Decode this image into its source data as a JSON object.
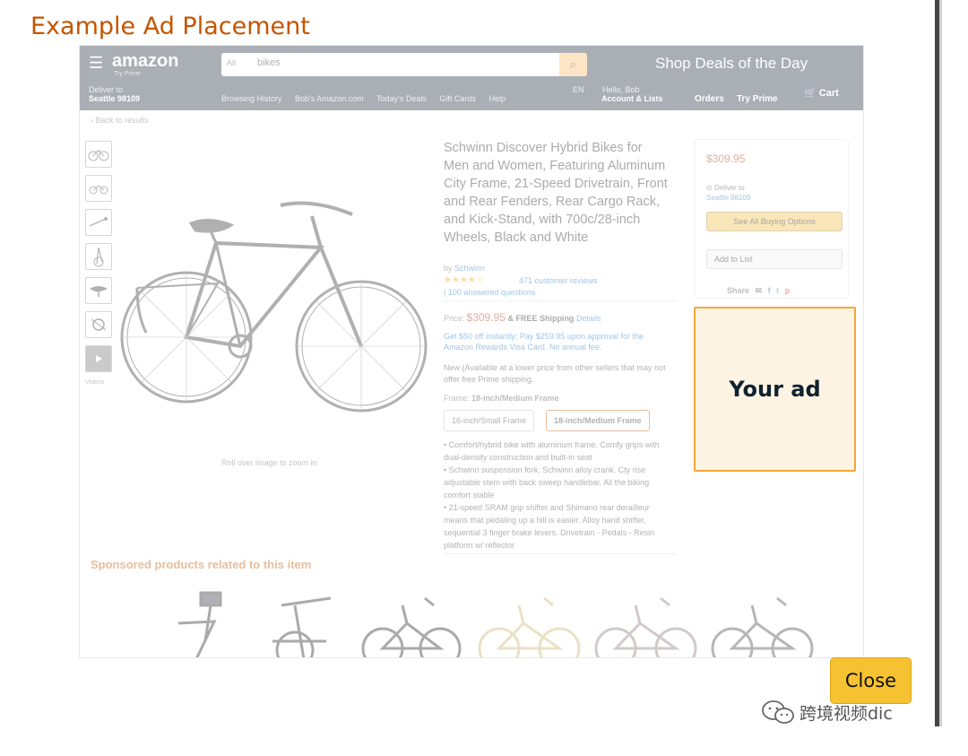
{
  "modal": {
    "title": "Example Ad Placement",
    "close_label": "Close"
  },
  "ad": {
    "label": "Your ad",
    "fill_color": "#fdf3e3",
    "border_color": "#f4a836"
  },
  "amazon_page": {
    "header": {
      "logo": "amazon",
      "logo_sub": "Try Prime",
      "search_department": "All",
      "search_query": "bikes",
      "deals_text": "Shop Deals of the Day",
      "deliver_line1": "Deliver to",
      "deliver_line2": "Seattle 98109",
      "links": [
        "Browsing History",
        "Bob's Amazon.com",
        "Today's Deals",
        "Gift Cards",
        "Help"
      ],
      "account_line1": "Hello, Bob",
      "account_line2": "Account & Lists",
      "orders": "Orders",
      "try_prime": "Try Prime",
      "cart": "Cart",
      "lang": "EN"
    },
    "back_link": "‹ Back to results",
    "product": {
      "title": "Schwinn Discover Hybrid Bikes for Men and Women, Featuring Aluminum City Frame, 21-Speed Drivetrain, Front and Rear Fenders, Rear Cargo Rack, and Kick-Stand, with 700c/28-inch Wheels, Black and White",
      "brand_prefix": "by",
      "brand": "Schwinn",
      "stars": "★★★★☆",
      "reviews": "471 customer reviews",
      "answered": "| 100 answered questions",
      "price_label": "Price:",
      "price": "$309.95",
      "shipping": "& FREE Shipping",
      "details": "Details",
      "promo": "Get $50 off instantly: Pay $259.95 upon approval for the Amazon Rewards Visa Card. No annual fee.",
      "new_available": "New (Available at a lower price from other sellers that may not offer free Prime shipping.",
      "frame_label": "Frame:",
      "frame_selected": "18-inch/Medium Frame",
      "frame_options": [
        "16-inch/Small Frame",
        "18-inch/Medium Frame"
      ],
      "bullets": [
        "Comfort/hybrid bike with aluminum frame. Comfy grips with dual-density construction and built-in seat",
        "Schwinn suspension fork. Schwinn alloy crank. Cty rise adjustable stem with back sweep handlebar. All the biking comfort stable",
        "21-speed SRAM grip shifter and Shimano rear derailleur means that pedaling up a hill is easier. Alloy hand shifter, sequential 3 finger brake levers. Drivetrain - Pedals - Resin platform w/ reflector"
      ],
      "rollover": "Roll over image to zoom in",
      "video_caption": "Videos"
    },
    "buybox": {
      "price": "$309.95",
      "deliver_line1": "Deliver to",
      "deliver_line2": "Seattle 98109",
      "buy_button": "See All Buying Options",
      "add_to_list": "Add to List",
      "share_label": "Share"
    },
    "sponsored_title": "Sponsored products related to this item"
  },
  "watermark": {
    "text": "跨境视频dic"
  }
}
